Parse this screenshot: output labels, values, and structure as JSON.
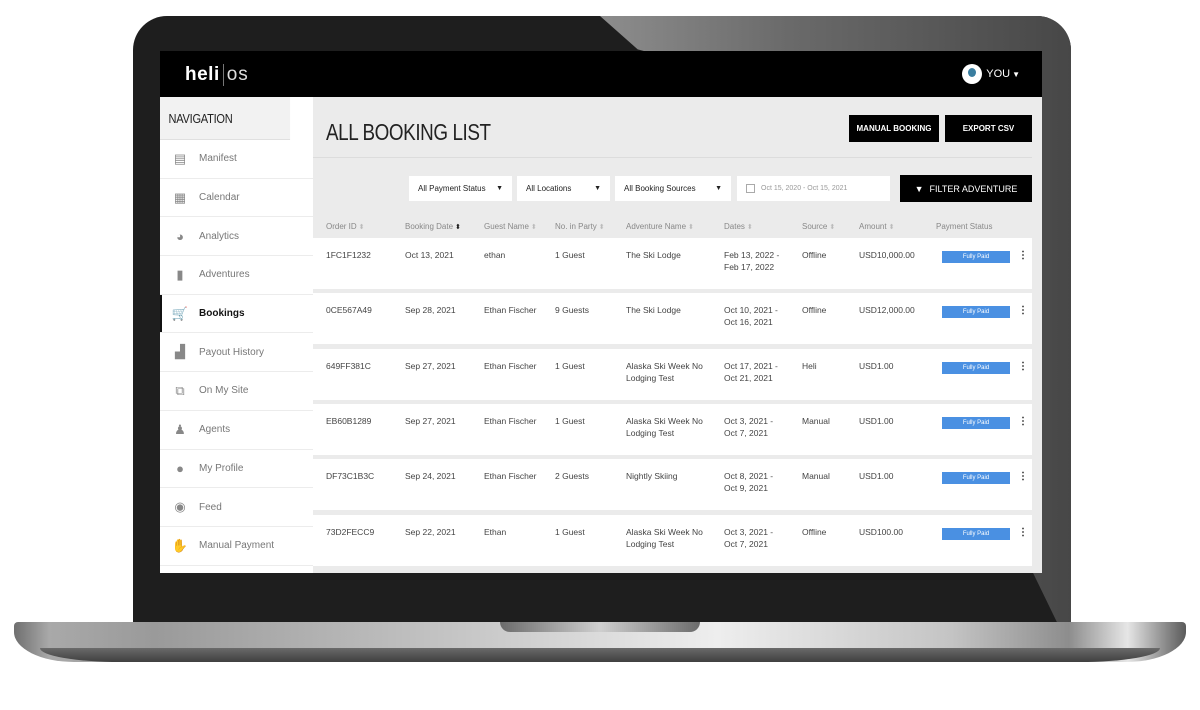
{
  "app": {
    "logo_bold": "heli",
    "logo_light": "os",
    "user_label": "YOU"
  },
  "sidebar": {
    "title": "NAVIGATION",
    "items": [
      {
        "label": "Manifest",
        "icon": "clipboard-icon",
        "glyph": "▤",
        "active": false
      },
      {
        "label": "Calendar",
        "icon": "calendar-icon",
        "glyph": "▦",
        "active": false
      },
      {
        "label": "Analytics",
        "icon": "pie-chart-icon",
        "glyph": "◕",
        "active": false
      },
      {
        "label": "Adventures",
        "icon": "briefcase-icon",
        "glyph": "▮",
        "active": false
      },
      {
        "label": "Bookings",
        "icon": "cart-icon",
        "glyph": "🛒",
        "active": true
      },
      {
        "label": "Payout History",
        "icon": "money-stack-icon",
        "glyph": "▟",
        "active": false
      },
      {
        "label": "On My Site",
        "icon": "code-window-icon",
        "glyph": "⧉",
        "active": false
      },
      {
        "label": "Agents",
        "icon": "agent-icon",
        "glyph": "♟",
        "active": false
      },
      {
        "label": "My Profile",
        "icon": "user-icon",
        "glyph": "●",
        "active": false
      },
      {
        "label": "Feed",
        "icon": "chat-bubble-icon",
        "glyph": "◉",
        "active": false
      },
      {
        "label": "Manual Payment",
        "icon": "hand-dollar-icon",
        "glyph": "✋",
        "active": false
      }
    ]
  },
  "main": {
    "title": "ALL BOOKING LIST",
    "manual_booking_label": "MANUAL BOOKING",
    "export_csv_label": "EXPORT CSV",
    "filters": {
      "payment_status": "All Payment Status",
      "locations": "All Locations",
      "booking_sources": "All Booking Sources",
      "date_range": "Oct 15, 2020 - Oct 15, 2021",
      "filter_button": "FILTER ADVENTURE"
    },
    "columns": [
      "Order ID",
      "Booking Date",
      "Guest Name",
      "No. in Party",
      "Adventure Name",
      "Dates",
      "Source",
      "Amount",
      "Payment Status"
    ],
    "rows": [
      {
        "order_id": "1FC1F1232",
        "booking_date": "Oct 13, 2021",
        "guest": "ethan",
        "party": "1 Guest",
        "adventure_1": "The Ski Lodge",
        "adventure_2": "",
        "dates_1": "Feb 13, 2022 -",
        "dates_2": "Feb 17, 2022",
        "source": "Offline",
        "amount": "USD10,000.00",
        "status": "Fully Paid"
      },
      {
        "order_id": "0CE567A49",
        "booking_date": "Sep 28, 2021",
        "guest": "Ethan Fischer",
        "party": "9 Guests",
        "adventure_1": "The Ski Lodge",
        "adventure_2": "",
        "dates_1": "Oct 10, 2021 -",
        "dates_2": "Oct 16, 2021",
        "source": "Offline",
        "amount": "USD12,000.00",
        "status": "Fully Paid"
      },
      {
        "order_id": "649FF381C",
        "booking_date": "Sep 27, 2021",
        "guest": "Ethan Fischer",
        "party": "1 Guest",
        "adventure_1": "Alaska Ski Week No",
        "adventure_2": "Lodging Test",
        "dates_1": "Oct 17, 2021 -",
        "dates_2": "Oct 21, 2021",
        "source": "Heli",
        "amount": "USD1.00",
        "status": "Fully Paid"
      },
      {
        "order_id": "EB60B1289",
        "booking_date": "Sep 27, 2021",
        "guest": "Ethan Fischer",
        "party": "1 Guest",
        "adventure_1": "Alaska Ski Week No",
        "adventure_2": "Lodging Test",
        "dates_1": "Oct 3, 2021 -",
        "dates_2": "Oct 7, 2021",
        "source": "Manual",
        "amount": "USD1.00",
        "status": "Fully Paid"
      },
      {
        "order_id": "DF73C1B3C",
        "booking_date": "Sep 24, 2021",
        "guest": "Ethan Fischer",
        "party": "2 Guests",
        "adventure_1": "Nightly Skiing",
        "adventure_2": "",
        "dates_1": "Oct 8, 2021 -",
        "dates_2": "Oct 9, 2021",
        "source": "Manual",
        "amount": "USD1.00",
        "status": "Fully Paid"
      },
      {
        "order_id": "73D2FECC9",
        "booking_date": "Sep 22, 2021",
        "guest": "Ethan",
        "party": "1 Guest",
        "adventure_1": "Alaska Ski Week No",
        "adventure_2": "Lodging Test",
        "dates_1": "Oct 3, 2021 -",
        "dates_2": "Oct 7, 2021",
        "source": "Offline",
        "amount": "USD100.00",
        "status": "Fully Paid"
      }
    ]
  },
  "colors": {
    "badge_blue": "#4a90e2",
    "topbar": "#000000",
    "background": "#ebebeb"
  }
}
